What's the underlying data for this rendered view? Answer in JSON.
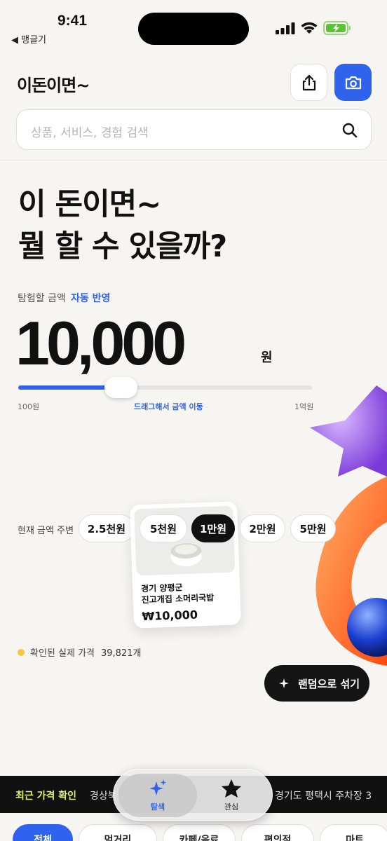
{
  "status_bar": {
    "time": "9:41",
    "back_app": "◀ 맹글기"
  },
  "header": {
    "title": "이돈이면~",
    "search_placeholder": "상품, 서비스, 경험 검색"
  },
  "hero": {
    "line1": "이 돈이면~",
    "line2": "뭘 할 수 있을까?",
    "amount_label": "탐험할 금액",
    "auto_label": "자동 반영",
    "amount": "10,000",
    "unit": "원"
  },
  "slider": {
    "min_label": "100원",
    "hint": "드래그해서 금액 이동",
    "max_label": "1억원",
    "fill_fraction": 0.3
  },
  "nearby": {
    "label": "현재 금액 주변",
    "chips": [
      "2.5천원",
      "5천원",
      "1만원",
      "2만원",
      "5만원"
    ],
    "active_index": 2
  },
  "card": {
    "title_line1": "경기 양평군",
    "title_line2": "진고개집 소머리국밥",
    "price": "₩10,000"
  },
  "verified": {
    "label": "확인된 실제 가격",
    "count": "39,821개"
  },
  "random_button": {
    "label": "랜덤으로 섞기"
  },
  "ticker": {
    "label": "최근 가격 확인",
    "item1": "경상북",
    "item2": "경기도 평택시 주차장 3"
  },
  "bottom_nav": {
    "tabs": [
      {
        "label": "탐색",
        "icon": "sparkle-icon"
      },
      {
        "label": "관심",
        "icon": "star-icon"
      }
    ]
  },
  "categories": [
    "전체",
    "먹거리",
    "카페/음료",
    "편의점",
    "마트"
  ],
  "colors": {
    "accent": "#2f63ee",
    "dark": "#111111",
    "ticker_label": "#d9f36a"
  }
}
